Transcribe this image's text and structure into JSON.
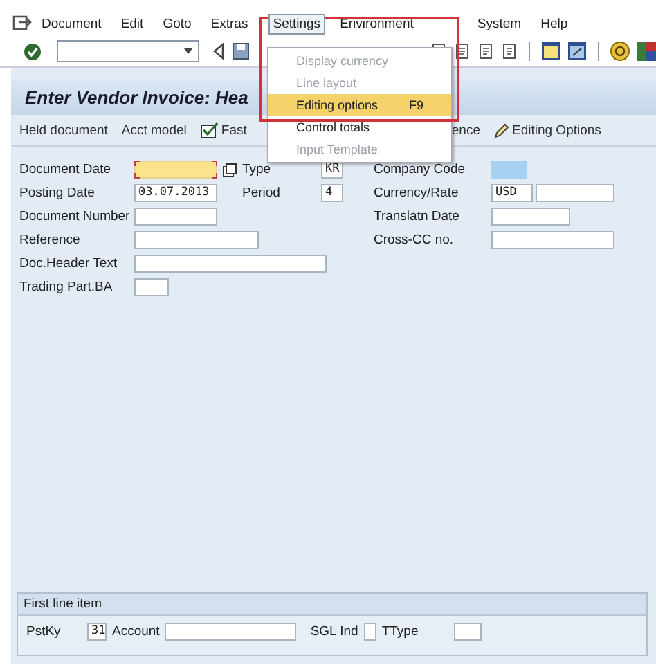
{
  "menu_bar": [
    {
      "label": "Document",
      "selected": false
    },
    {
      "label": "Edit",
      "selected": false
    },
    {
      "label": "Goto",
      "selected": false
    },
    {
      "label": "Extras",
      "selected": false
    },
    {
      "label": "Settings",
      "selected": true
    },
    {
      "label": "Environment",
      "selected": false
    },
    {
      "label": "System",
      "selected": false
    },
    {
      "label": "Help",
      "selected": false
    }
  ],
  "settings_menu": [
    {
      "label": "Display currency",
      "disabled": true,
      "selected": false
    },
    {
      "label": "Line layout",
      "disabled": true,
      "selected": false
    },
    {
      "label": "Editing options",
      "shortcut": "F9",
      "disabled": false,
      "selected": true
    },
    {
      "label": "Control totals",
      "disabled": false,
      "selected": false
    },
    {
      "label": "Input Template",
      "disabled": true,
      "selected": false
    }
  ],
  "title": "Enter Vendor Invoice: Hea",
  "app_toolbar": [
    {
      "label": "Held document",
      "kind": "text"
    },
    {
      "label": "Acct model",
      "kind": "text"
    },
    {
      "label": "Fast",
      "kind": "fast"
    },
    {
      "label": "ence",
      "kind": "text"
    },
    {
      "label": "Editing Options",
      "kind": "edit"
    }
  ],
  "header_fields": [
    {
      "label": "Document Date",
      "kind": "focused"
    },
    {
      "label": "Posting Date",
      "value": "03.07.2013",
      "kind": "plain"
    },
    {
      "label": "Document Number",
      "kind": "plain"
    },
    {
      "label": "Reference",
      "kind": "plain"
    },
    {
      "label": "Doc.Header Text",
      "kind": "plain"
    },
    {
      "label": "Trading Part.BA",
      "kind": "plain"
    }
  ],
  "type_fields": [
    {
      "label": "Type",
      "value": "KR"
    },
    {
      "label": "Period",
      "value": "4"
    }
  ],
  "company_fields": [
    {
      "label": "Company Code",
      "kind": "highlighted"
    },
    {
      "label": "Currency/Rate",
      "value": "USD",
      "kind": "pair"
    },
    {
      "label": "Translatn Date",
      "kind": "plain"
    },
    {
      "label": "Cross-CC no.",
      "kind": "plain"
    }
  ],
  "first_line_item": {
    "title": "First line item",
    "fields": [
      {
        "label": "PstKy",
        "value": "31"
      },
      {
        "label": "Account"
      },
      {
        "label": "SGL Ind"
      },
      {
        "label": "TType"
      }
    ]
  }
}
